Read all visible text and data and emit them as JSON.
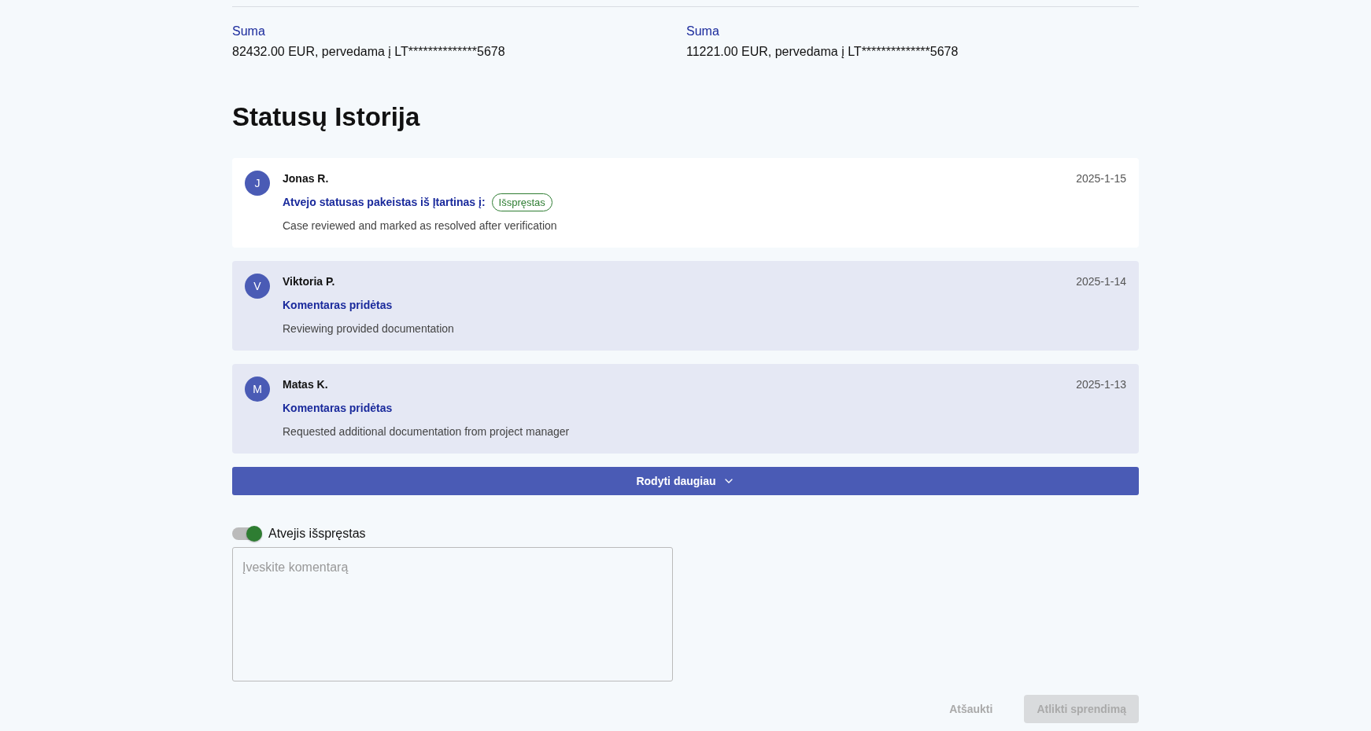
{
  "transfers": [
    {
      "label": "Suma",
      "value": "82432.00 EUR, pervedama į LT**************5678"
    },
    {
      "label": "Suma",
      "value": "11221.00 EUR, pervedama į LT**************5678"
    }
  ],
  "history": {
    "title": "Statusų Istorija",
    "entries": [
      {
        "kind": "status_change",
        "initial": "J",
        "author": "Jonas R.",
        "date": "2025-1-15",
        "action": "Atvejo statusas pakeistas iš Įtartinas į:",
        "badge": "Išspręstas",
        "comment": "Case reviewed and marked as resolved after verification"
      },
      {
        "kind": "comment",
        "initial": "V",
        "author": "Viktoria P.",
        "date": "2025-1-14",
        "action": "Komentaras pridėtas",
        "comment": "Reviewing provided documentation"
      },
      {
        "kind": "comment",
        "initial": "M",
        "author": "Matas K.",
        "date": "2025-1-13",
        "action": "Komentaras pridėtas",
        "comment": "Requested additional documentation from project manager"
      }
    ],
    "more_button": "Rodyti daugiau"
  },
  "resolved_toggle": {
    "label": "Atvejis išspręstas",
    "on": true
  },
  "comment_field": {
    "placeholder": "Įveskite komentarą"
  },
  "actions": [
    {
      "label": "Atšaukti",
      "kind": "text",
      "disabled": true
    },
    {
      "label": "Atlikti sprendimą",
      "kind": "filled",
      "disabled": true
    }
  ]
}
